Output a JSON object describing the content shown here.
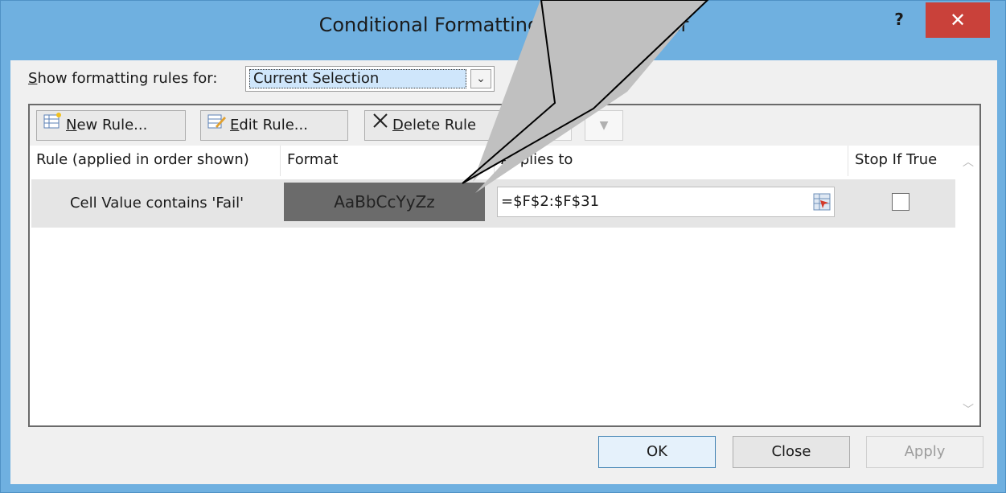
{
  "window": {
    "title": "Conditional Formatting Rules Manager",
    "help_glyph": "?",
    "close_glyph": "✕"
  },
  "filter": {
    "label_prefix": "S",
    "label_rest": "how formatting rules for:",
    "selected": "Current Selection",
    "arrow_glyph": "⌄"
  },
  "toolbar": {
    "new_rule_u": "N",
    "new_rule_rest": "ew Rule...",
    "edit_rule_u": "E",
    "edit_rule_rest": "dit Rule...",
    "delete_rule_u": "D",
    "delete_rule_rest": "elete Rule",
    "move_up_glyph": "▲",
    "move_down_glyph": "▼"
  },
  "table": {
    "columns": [
      "Rule (applied in order shown)",
      "Format",
      "Applies to",
      "Stop If True"
    ],
    "rows": [
      {
        "rule": "Cell Value contains 'Fail'",
        "format_preview": "AaBbCcYyZz",
        "applies_to": "=$F$2:$F$31",
        "stop_if_true": false
      }
    ]
  },
  "buttons": {
    "ok": "OK",
    "close": "Close",
    "apply": "Apply"
  },
  "colors": {
    "title_bar": "#6fb0e0",
    "close_button": "#c9413a",
    "selected_row": "#e5e5e5",
    "format_preview_fill": "#6b6b6b",
    "callout_fill": "#c0c0c0"
  }
}
